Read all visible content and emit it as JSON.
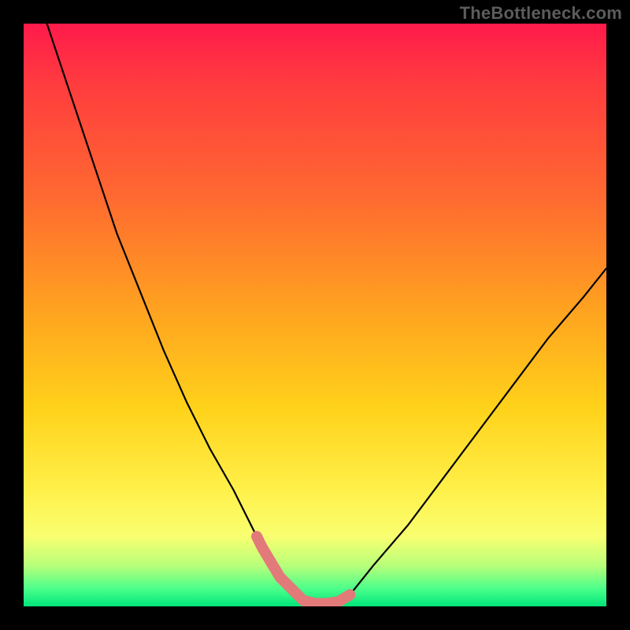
{
  "watermark": "TheBottleneck.com",
  "colors": {
    "background": "#000000",
    "watermark_text": "#5c5c5c",
    "curve": "#000000",
    "highlight": "#e27a7a",
    "gradient_stops": [
      "#ff1a4b",
      "#ff3b3f",
      "#ff6a30",
      "#ffa51f",
      "#ffd21a",
      "#fff04a",
      "#f9ff70",
      "#b8ff7a",
      "#4aff8a",
      "#00e57a"
    ]
  },
  "chart_data": {
    "type": "line",
    "title": "",
    "xlabel": "",
    "ylabel": "",
    "xlim": [
      0,
      100
    ],
    "ylim": [
      0,
      100
    ],
    "annotations": [],
    "series": [
      {
        "name": "main-curve",
        "x": [
          4,
          8,
          12,
          16,
          20,
          24,
          28,
          32,
          36,
          40,
          41,
          44,
          48,
          50,
          52,
          54,
          56,
          60,
          66,
          72,
          78,
          84,
          90,
          96,
          100
        ],
        "y": [
          100,
          88,
          76,
          64,
          54,
          44,
          35,
          27,
          20,
          12,
          10,
          5,
          1,
          0.5,
          0.5,
          0.8,
          2,
          7,
          14,
          22,
          30,
          38,
          46,
          53,
          58
        ]
      }
    ],
    "highlight_segment": {
      "name": "bottom-highlight",
      "x": [
        40,
        41,
        44,
        48,
        50,
        52,
        54,
        56
      ],
      "y": [
        12,
        10,
        5,
        1,
        0.5,
        0.5,
        0.8,
        2
      ]
    }
  }
}
